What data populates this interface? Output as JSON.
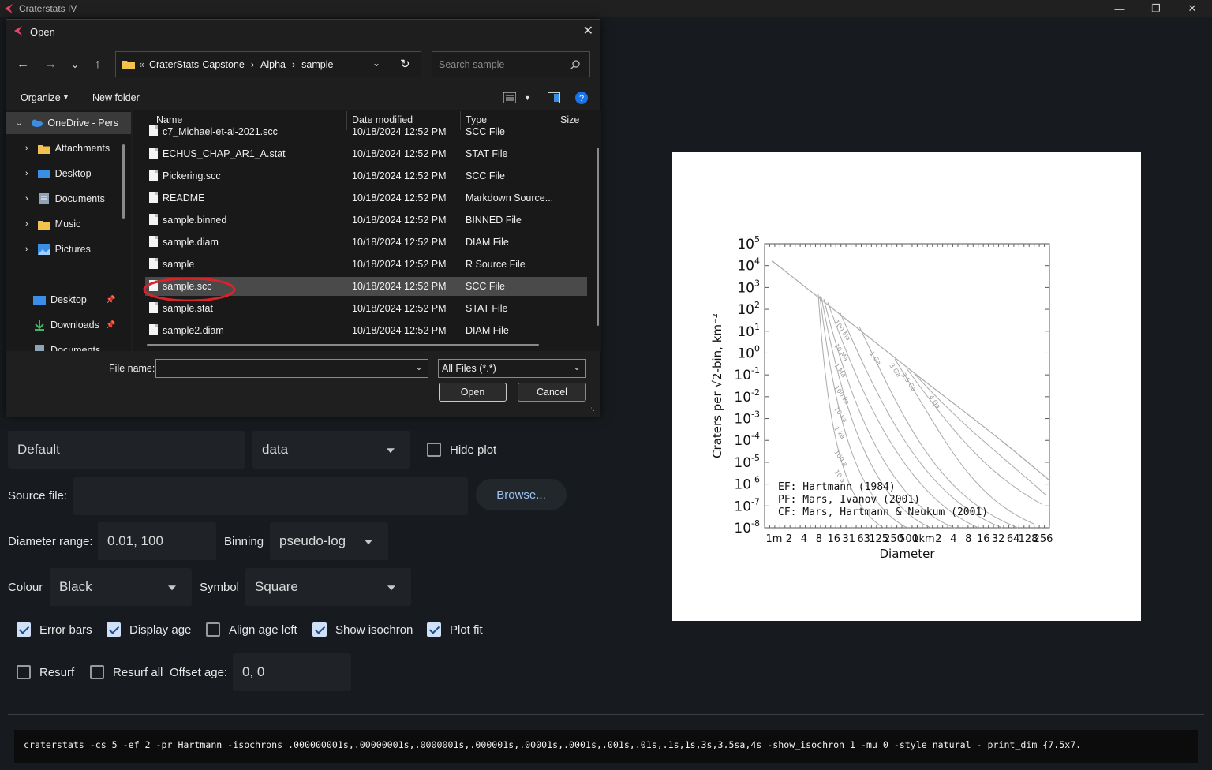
{
  "app": {
    "title": "Craterstats IV"
  },
  "dialog": {
    "title": "Open",
    "breadcrumb": [
      "CraterStats-Capstone",
      "Alpha",
      "sample"
    ],
    "search_placeholder": "Search sample",
    "toolbar": {
      "organize": "Organize",
      "new_folder": "New folder"
    },
    "nav": [
      {
        "label": "OneDrive - Pers"
      },
      {
        "label": "Attachments"
      },
      {
        "label": "Desktop"
      },
      {
        "label": "Documents"
      },
      {
        "label": "Music"
      },
      {
        "label": "Pictures"
      },
      {
        "label": "Desktop"
      },
      {
        "label": "Downloads"
      },
      {
        "label": "Documents"
      }
    ],
    "columns": {
      "name": "Name",
      "date": "Date modified",
      "type": "Type",
      "size": "Size"
    },
    "files": [
      {
        "name": "c7_Michael-et-al-2021.scc",
        "date": "10/18/2024 12:52 PM",
        "type": "SCC File"
      },
      {
        "name": "ECHUS_CHAP_AR1_A.stat",
        "date": "10/18/2024 12:52 PM",
        "type": "STAT File"
      },
      {
        "name": "Pickering.scc",
        "date": "10/18/2024 12:52 PM",
        "type": "SCC File"
      },
      {
        "name": "README",
        "date": "10/18/2024 12:52 PM",
        "type": "Markdown Source..."
      },
      {
        "name": "sample.binned",
        "date": "10/18/2024 12:52 PM",
        "type": "BINNED File"
      },
      {
        "name": "sample.diam",
        "date": "10/18/2024 12:52 PM",
        "type": "DIAM File"
      },
      {
        "name": "sample",
        "date": "10/18/2024 12:52 PM",
        "type": "R Source File"
      },
      {
        "name": "sample.scc",
        "date": "10/18/2024 12:52 PM",
        "type": "SCC File"
      },
      {
        "name": "sample.stat",
        "date": "10/18/2024 12:52 PM",
        "type": "STAT File"
      },
      {
        "name": "sample2.diam",
        "date": "10/18/2024 12:52 PM",
        "type": "DIAM File"
      }
    ],
    "file_name_label": "File name:",
    "file_name_value": "",
    "filter": "All Files (*.*)",
    "open_button": "Open",
    "cancel_button": "Cancel"
  },
  "main": {
    "plot_name": "Default",
    "plot_type": "data",
    "hide_plot": "Hide plot",
    "source_file_label": "Source file:",
    "source_file_value": "",
    "browse": "Browse...",
    "diameter_range_label": "Diameter range:",
    "diameter_range": "0.01, 100",
    "binning_label": "Binning",
    "binning": "pseudo-log",
    "colour_label": "Colour",
    "colour": "Black",
    "symbol_label": "Symbol",
    "symbol": "Square",
    "checks": {
      "error_bars": "Error bars",
      "display_age": "Display age",
      "align_age_left": "Align age left",
      "show_isochron": "Show isochron",
      "plot_fit": "Plot fit",
      "resurf": "Resurf",
      "resurf_all": "Resurf all"
    },
    "offset_age_label": "Offset age:",
    "offset_age": "0, 0",
    "command": "craterstats -cs 5 -ef 2 -pr Hartmann -isochrons .000000001s,.00000001s,.0000001s,.000001s,.00001s,.0001s,.001s,.01s,.1s,1s,3s,3.5sa,4s -show_isochron 1 -mu 0 -style natural - print_dim {7.5x7."
  },
  "chart_data": {
    "type": "line",
    "xlabel": "Diameter",
    "ylabel": "Craters per √2-bin, km⁻²",
    "x_ticks": [
      "1m",
      "2",
      "4",
      "8",
      "16",
      "31",
      "63",
      "125",
      "250",
      "500",
      "1km",
      "2",
      "4",
      "8",
      "16",
      "32",
      "64",
      "128",
      "256"
    ],
    "y_ticks": [
      "10^5",
      "10^4",
      "10^3",
      "10^2",
      "10^1",
      "10^0",
      "10^-1",
      "10^-2",
      "10^-3",
      "10^-4",
      "10^-5",
      "10^-6",
      "10^-7",
      "10^-8"
    ],
    "ylim": [
      1e-08,
      100000.0
    ],
    "scale": "log-log",
    "isochron_labels": [
      "100 Ma",
      "10 Ma",
      "1 Ma",
      "100 ka",
      "10 ka",
      "1 ka",
      "100 a",
      "10 a",
      "1 Ga",
      "3 Ga",
      "3.5 Ga",
      "4 Ga"
    ],
    "annotations": [
      "EF: Hartmann (1984)",
      "PF: Mars, Ivanov (2001)",
      "CF: Mars, Hartmann & Neukum (2001)"
    ],
    "line_color": "#aaaaaa"
  }
}
